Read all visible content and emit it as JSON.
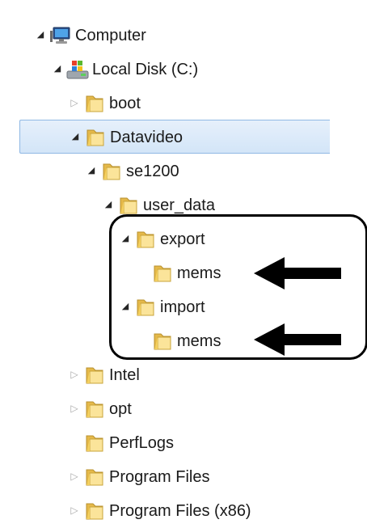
{
  "tree": {
    "items": [
      {
        "label": "Computer",
        "depth": 0,
        "expander": "open",
        "icon": "computer-icon"
      },
      {
        "label": "Local Disk (C:)",
        "depth": 1,
        "expander": "open",
        "icon": "drive-icon"
      },
      {
        "label": "boot",
        "depth": 2,
        "expander": "closed",
        "icon": "folder-icon"
      },
      {
        "label": "Datavideo",
        "depth": 2,
        "expander": "open",
        "icon": "folder-icon",
        "selected": true
      },
      {
        "label": "se1200",
        "depth": 3,
        "expander": "open",
        "icon": "folder-icon"
      },
      {
        "label": "user_data",
        "depth": 4,
        "expander": "open",
        "icon": "folder-icon"
      },
      {
        "label": "export",
        "depth": 5,
        "expander": "open",
        "icon": "folder-icon"
      },
      {
        "label": "mems",
        "depth": 6,
        "expander": "none",
        "icon": "folder-icon"
      },
      {
        "label": "import",
        "depth": 5,
        "expander": "open",
        "icon": "folder-icon"
      },
      {
        "label": "mems",
        "depth": 6,
        "expander": "none",
        "icon": "folder-icon"
      },
      {
        "label": "Intel",
        "depth": 2,
        "expander": "closed",
        "icon": "folder-icon"
      },
      {
        "label": "opt",
        "depth": 2,
        "expander": "closed",
        "icon": "folder-icon"
      },
      {
        "label": "PerfLogs",
        "depth": 2,
        "expander": "none",
        "icon": "folder-icon"
      },
      {
        "label": "Program Files",
        "depth": 2,
        "expander": "closed",
        "icon": "folder-icon"
      },
      {
        "label": "Program Files (x86)",
        "depth": 2,
        "expander": "closed",
        "icon": "folder-icon"
      }
    ]
  },
  "annotation": {
    "callout_color": "#000000",
    "arrow_targets": [
      "export/mems",
      "import/mems"
    ]
  },
  "colors": {
    "selection_fill": "#d9e8f9",
    "selection_border": "#8fb8e4",
    "folder_yellow": "#f3cf5e"
  }
}
